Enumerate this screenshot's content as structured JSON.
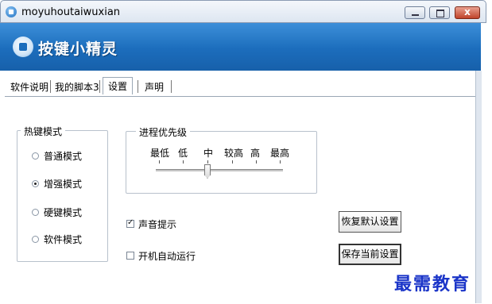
{
  "window": {
    "title": "moyuhoutaiwuxian",
    "close_glyph": "x"
  },
  "banner": {
    "brand": "按键小精灵"
  },
  "tabs": [
    {
      "label": "软件说明"
    },
    {
      "label": "我的脚本3"
    },
    {
      "label": "设置"
    },
    {
      "label": "声明"
    }
  ],
  "active_tab": "设置",
  "hotkey_group": {
    "title": "热键模式",
    "options": [
      {
        "label": "普通模式",
        "checked": false
      },
      {
        "label": "增强模式",
        "checked": true
      },
      {
        "label": "硬键模式",
        "checked": false
      },
      {
        "label": "软件模式",
        "checked": false
      }
    ]
  },
  "priority_group": {
    "title": "进程优先级",
    "levels": [
      "最低",
      "低",
      "中",
      "较高",
      "高",
      "最高"
    ],
    "selected": "中"
  },
  "checkboxes": [
    {
      "label": "声音提示",
      "checked": true
    },
    {
      "label": "开机自动运行",
      "checked": false
    }
  ],
  "buttons": {
    "restore_defaults": "恢复默认设置",
    "save_current": "保存当前设置"
  },
  "watermark": "最需教育"
}
